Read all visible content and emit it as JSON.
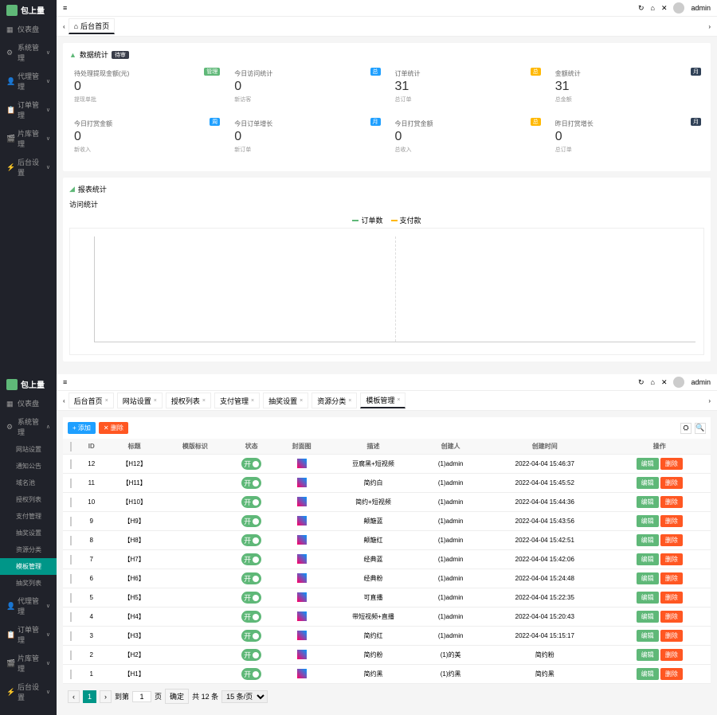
{
  "brand": "包上量",
  "topbar": {
    "collapse": "≡",
    "user": "admin",
    "refresh_icon": "↻",
    "home_icon": "⌂",
    "close_icon": "✕"
  },
  "panel1": {
    "sidebar": [
      {
        "label": "仪表盘",
        "icon": "▦"
      },
      {
        "label": "系统管理",
        "icon": "⚙",
        "arrow": "∨"
      },
      {
        "label": "代理管理",
        "icon": "👤",
        "arrow": "∨"
      },
      {
        "label": "订单管理",
        "icon": "📋",
        "arrow": "∨"
      },
      {
        "label": "片库管理",
        "icon": "🎬",
        "arrow": "∨"
      },
      {
        "label": "后台设置",
        "icon": "⚡",
        "arrow": "∨"
      }
    ],
    "tab_home": "后台首页",
    "stats_title": "数据统计",
    "stats_badge": "待审",
    "stats": [
      {
        "label": "待处理提现金额(元)",
        "value": "0",
        "sub": "提现单批",
        "tag": "管理",
        "tagClass": "tag-green"
      },
      {
        "label": "今日访问统计",
        "value": "0",
        "sub": "新访客",
        "tag": "总",
        "tagClass": "tag-blue"
      },
      {
        "label": "订单统计",
        "value": "31",
        "sub": "总订单",
        "tag": "总",
        "tagClass": "tag-orange"
      },
      {
        "label": "金额统计",
        "value": "31",
        "sub": "总金额",
        "tag": "月",
        "tagClass": "tag-cyan"
      },
      {
        "label": "今日打赏金额",
        "value": "0",
        "sub": "新收入",
        "tag": "周",
        "tagClass": "tag-blue"
      },
      {
        "label": "今日订单增长",
        "value": "0",
        "sub": "新订单",
        "tag": "月",
        "tagClass": "tag-blue"
      },
      {
        "label": "今日打赏金额",
        "value": "0",
        "sub": "总收入",
        "tag": "总",
        "tagClass": "tag-orange"
      },
      {
        "label": "昨日打赏增长",
        "value": "0",
        "sub": "总订单",
        "tag": "月",
        "tagClass": "tag-cyan"
      }
    ],
    "report_title": "报表统计",
    "chart_title": "访问统计",
    "legend": [
      {
        "label": "订单数",
        "color": "#5fb878"
      },
      {
        "label": "支付款",
        "color": "#ffb800"
      }
    ]
  },
  "panel2": {
    "sidebar": [
      {
        "label": "仪表盘",
        "icon": "▦"
      },
      {
        "label": "系统管理",
        "icon": "⚙",
        "arrow": "∧",
        "open": true,
        "sub": [
          {
            "label": "网站设置"
          },
          {
            "label": "通知公告"
          },
          {
            "label": "域名池"
          },
          {
            "label": "授权列表"
          },
          {
            "label": "支付管理"
          },
          {
            "label": "抽奖设置"
          },
          {
            "label": "资源分类"
          },
          {
            "label": "模板管理",
            "active": true
          },
          {
            "label": "抽奖列表"
          }
        ]
      },
      {
        "label": "代理管理",
        "icon": "👤",
        "arrow": "∨"
      },
      {
        "label": "订单管理",
        "icon": "📋",
        "arrow": "∨"
      },
      {
        "label": "片库管理",
        "icon": "🎬",
        "arrow": "∨"
      },
      {
        "label": "后台设置",
        "icon": "⚡",
        "arrow": "∨"
      }
    ],
    "tabs": [
      {
        "label": "后台首页"
      },
      {
        "label": "网站设置"
      },
      {
        "label": "授权列表"
      },
      {
        "label": "支付管理"
      },
      {
        "label": "抽奖设置"
      },
      {
        "label": "资源分类"
      },
      {
        "label": "模板管理",
        "active": true
      }
    ],
    "toolbar": {
      "add": "+ 添加",
      "delete": "✕ 删除"
    },
    "columns": [
      "",
      "ID",
      "标题",
      "模版标识",
      "状态",
      "封面图",
      "描述",
      "创建人",
      "创建时间",
      "操作"
    ],
    "rows": [
      {
        "id": "12",
        "title": "【H12】",
        "status": "开",
        "desc": "豆腐黑+短视频",
        "creator": "(1)admin",
        "time": "2022-04-04 15:46:37"
      },
      {
        "id": "11",
        "title": "【H11】",
        "status": "开",
        "desc": "简约白",
        "creator": "(1)admin",
        "time": "2022-04-04 15:45:52"
      },
      {
        "id": "10",
        "title": "【H10】",
        "status": "开",
        "desc": "简约+短视频",
        "creator": "(1)admin",
        "time": "2022-04-04 15:44:36"
      },
      {
        "id": "9",
        "title": "【H9】",
        "status": "开",
        "desc": "颠簸蓝",
        "creator": "(1)admin",
        "time": "2022-04-04 15:43:56"
      },
      {
        "id": "8",
        "title": "【H8】",
        "status": "开",
        "desc": "颠簸红",
        "creator": "(1)admin",
        "time": "2022-04-04 15:42:51"
      },
      {
        "id": "7",
        "title": "【H7】",
        "status": "开",
        "desc": "经典蓝",
        "creator": "(1)admin",
        "time": "2022-04-04 15:42:06"
      },
      {
        "id": "6",
        "title": "【H6】",
        "status": "开",
        "desc": "经典粉",
        "creator": "(1)admin",
        "time": "2022-04-04 15:24:48"
      },
      {
        "id": "5",
        "title": "【H5】",
        "status": "开",
        "desc": "可直播",
        "creator": "(1)admin",
        "time": "2022-04-04 15:22:35"
      },
      {
        "id": "4",
        "title": "【H4】",
        "status": "开",
        "desc": "带短视频+直播",
        "creator": "(1)admin",
        "time": "2022-04-04 15:20:43"
      },
      {
        "id": "3",
        "title": "【H3】",
        "status": "开",
        "desc": "简约红",
        "creator": "(1)admin",
        "time": "2022-04-04 15:15:17"
      },
      {
        "id": "2",
        "title": "【H2】",
        "status": "开",
        "desc": "简约粉",
        "creator": "(1)的美",
        "time": "简约粉"
      },
      {
        "id": "1",
        "title": "【H1】",
        "status": "开",
        "desc": "简约黑",
        "creator": "(1)约黑",
        "time": "简约黑"
      }
    ],
    "action_edit": "编辑",
    "action_delete": "删除",
    "pagination": {
      "prev": "‹",
      "page1": "1",
      "next": "›",
      "goto": "到第",
      "page_unit": "页",
      "confirm": "确定",
      "total": "共 12 条",
      "per_page": "15 条/页"
    }
  },
  "chart_data": {
    "type": "line",
    "title": "访问统计",
    "series": [
      {
        "name": "订单数",
        "values": []
      },
      {
        "name": "支付款",
        "values": []
      }
    ],
    "xlabel": "",
    "ylabel": "",
    "ylim": [
      0,
      1
    ]
  }
}
